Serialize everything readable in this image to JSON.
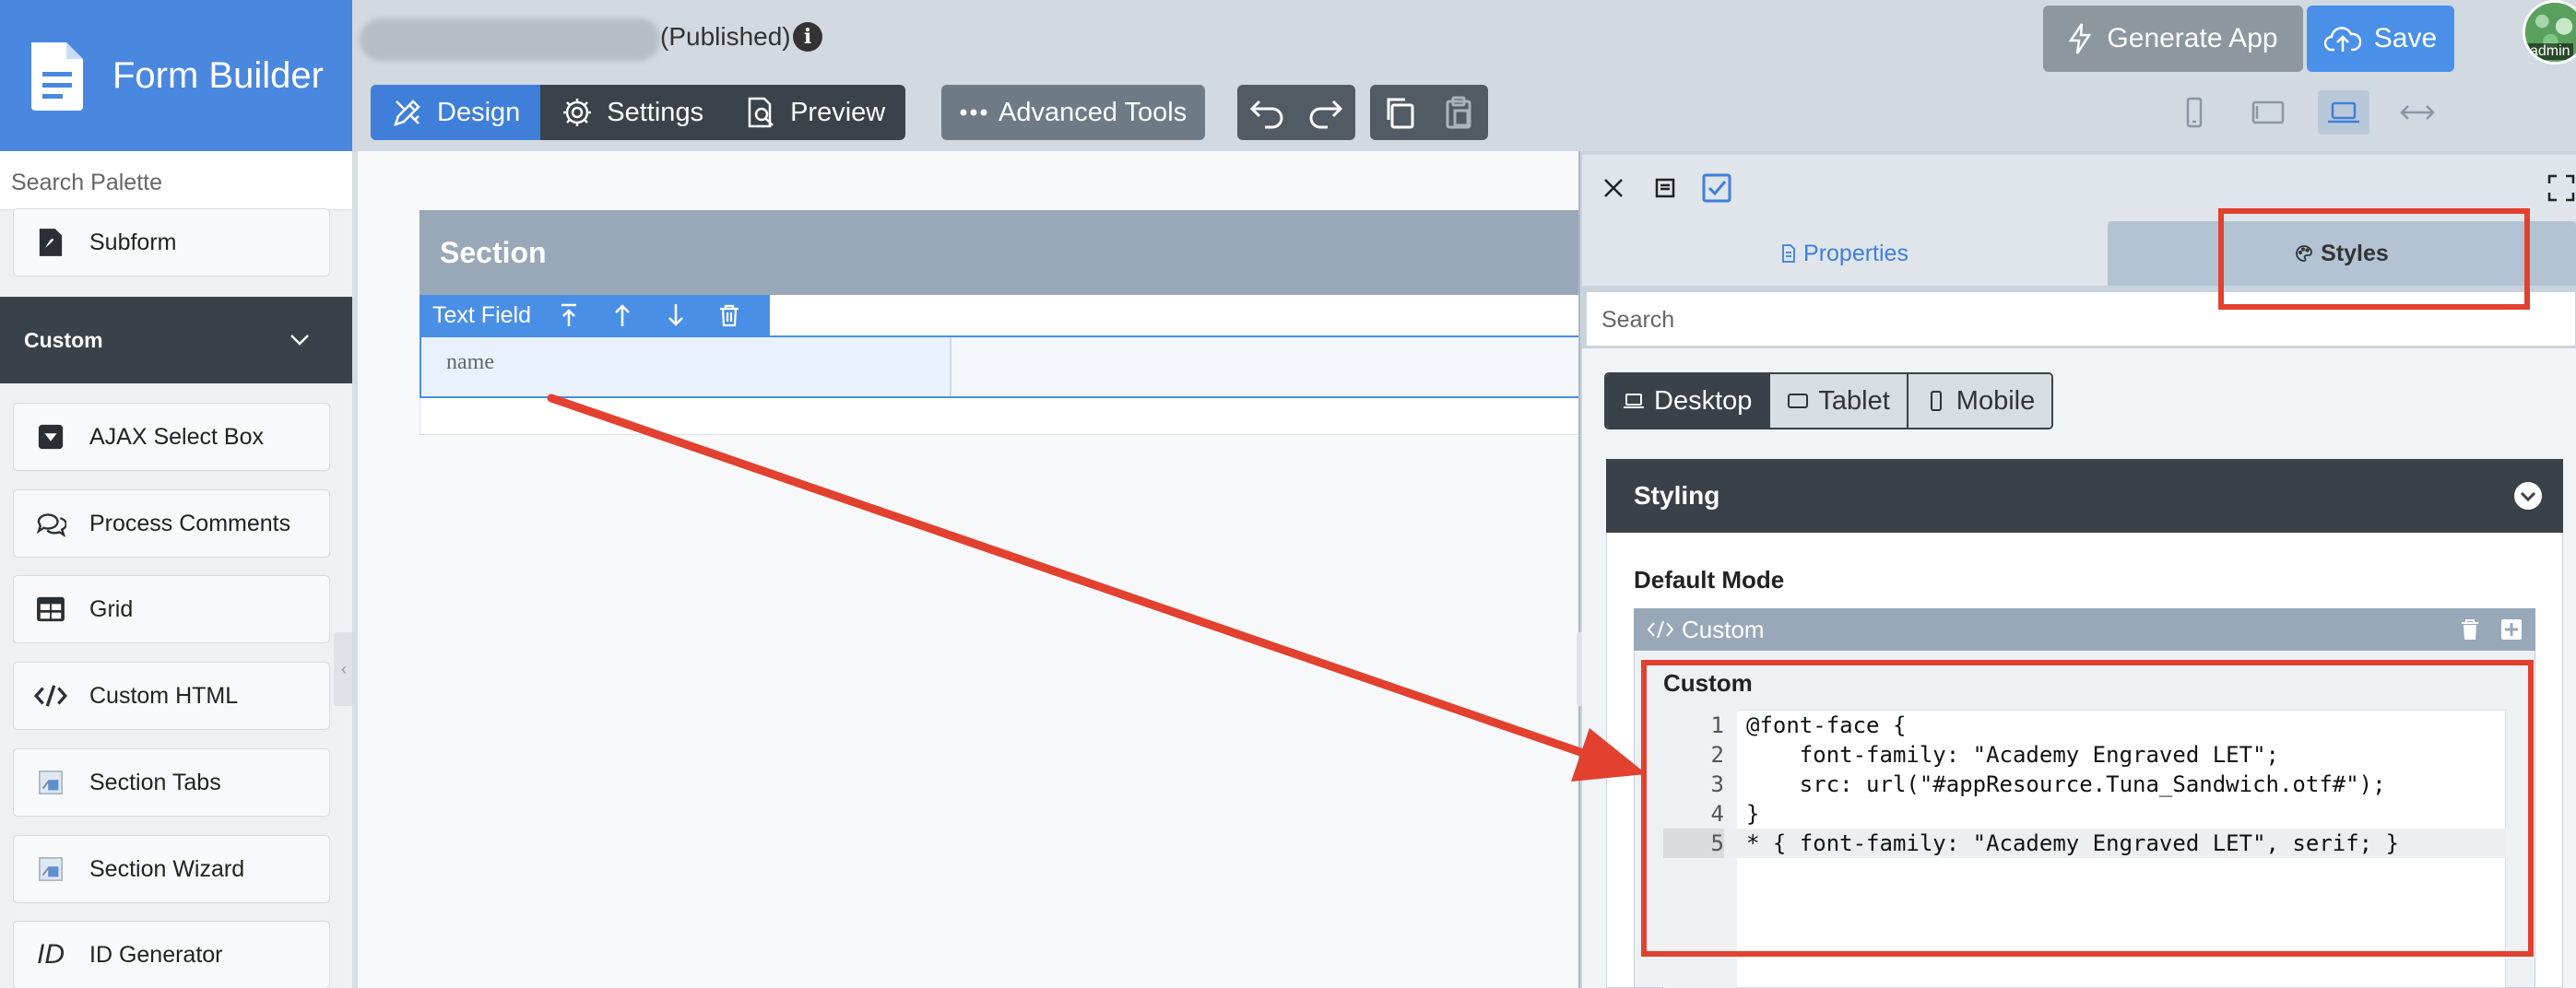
{
  "app": {
    "brand_title": "Form Builder",
    "status": "(Published)",
    "info_glyph": "i",
    "avatar_label": "admin"
  },
  "toolbar": {
    "design_label": "Design",
    "settings_label": "Settings",
    "preview_label": "Preview",
    "advanced_label": "Advanced Tools",
    "generate_label": "Generate App",
    "save_label": "Save"
  },
  "sidebar": {
    "search_placeholder": "Search Palette",
    "subform_label": "Subform",
    "custom_header": "Custom",
    "items": [
      {
        "label": "AJAX Select Box",
        "icon": "dropdown-icon"
      },
      {
        "label": "Process Comments",
        "icon": "comments-icon"
      },
      {
        "label": "Grid",
        "icon": "grid-icon"
      },
      {
        "label": "Custom HTML",
        "icon": "code-icon"
      },
      {
        "label": "Section Tabs",
        "icon": "image-icon"
      },
      {
        "label": "Section Wizard",
        "icon": "image-icon"
      },
      {
        "label": "ID Generator",
        "icon": "id-icon"
      }
    ],
    "id_glyph": "ID"
  },
  "canvas": {
    "section_title": "Section",
    "field_toolbar_label": "Text Field",
    "field_label": "name"
  },
  "panel": {
    "tab_properties": "Properties",
    "tab_styles": "Styles",
    "search_placeholder": "Search",
    "device_tabs": [
      "Desktop",
      "Tablet",
      "Mobile"
    ],
    "styling_title": "Styling",
    "default_mode_label": "Default Mode",
    "custom_block_title": "Custom",
    "custom_editor_title": "Custom",
    "code_lines": [
      {
        "n": "1",
        "text": "@font-face {"
      },
      {
        "n": "2",
        "text": "    font-family: \"Academy Engraved LET\";"
      },
      {
        "n": "3",
        "text": "    src: url(\"#appResource.Tuna_Sandwich.otf#\");"
      },
      {
        "n": "4",
        "text": "}"
      },
      {
        "n": "5",
        "text": "* { font-family: \"Academy Engraved LET\", serif; }"
      }
    ]
  },
  "colors": {
    "brand_blue": "#4a88e0",
    "active_blue": "#3f7fd9",
    "dark_bar": "#3a4148",
    "annotation_red": "#e2412f"
  }
}
